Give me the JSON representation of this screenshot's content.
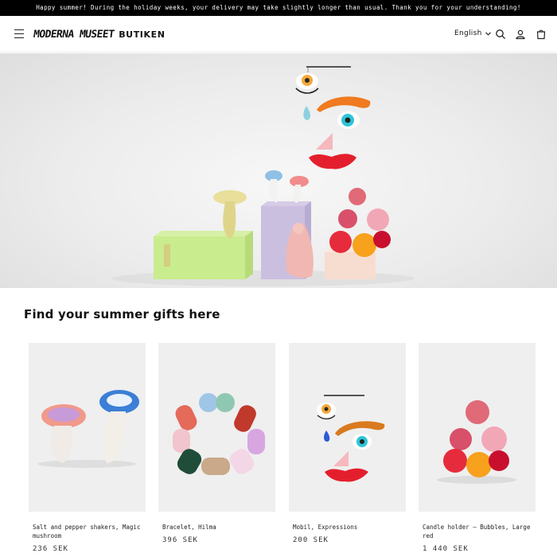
{
  "announcement": "Happy summer! During the holiday weeks, your delivery may take slightly longer than usual. Thank you for your understanding!",
  "header": {
    "logo_text": "Moderna Museet",
    "logo_sub": "BUTIKEN",
    "language": "English"
  },
  "icons": {
    "menu": "hamburger-menu-icon",
    "search": "search-icon",
    "account": "user-icon",
    "cart": "cart-icon",
    "language_caret": "chevron-down-icon"
  },
  "section": {
    "title": "Find your summer gifts here"
  },
  "products": [
    {
      "name": "Salt and pepper shakers, Magic mushroom",
      "price": "236 SEK"
    },
    {
      "name": "Bracelet, Hilma",
      "price": "396 SEK"
    },
    {
      "name": "Mobil, Expressions",
      "price": "200 SEK"
    },
    {
      "name": "Candle holder – Bubbles, Large red",
      "price": "1 440 SEK"
    }
  ]
}
